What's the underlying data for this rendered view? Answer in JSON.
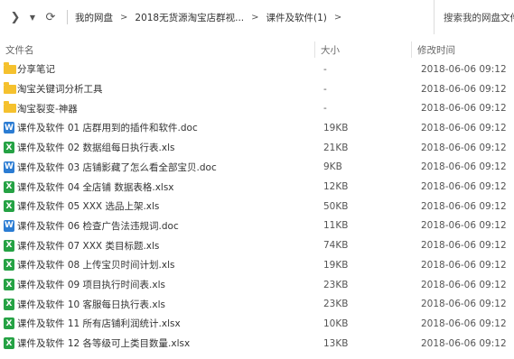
{
  "toolbar": {
    "breadcrumbs": [
      "我的网盘",
      "2018无货源淘宝店群视...",
      "课件及软件(1)"
    ],
    "search_placeholder": "搜索我的网盘文件"
  },
  "columns": {
    "name": "文件名",
    "size": "大小",
    "modified": "修改时间"
  },
  "files": [
    {
      "type": "folder",
      "name": "分享笔记",
      "size": "-",
      "date": "2018-06-06 09:12"
    },
    {
      "type": "folder",
      "name": "淘宝关键词分析工具",
      "size": "-",
      "date": "2018-06-06 09:12"
    },
    {
      "type": "folder",
      "name": "淘宝裂变-神器",
      "size": "-",
      "date": "2018-06-06 09:12"
    },
    {
      "type": "doc",
      "name": "课件及软件 01 店群用到的插件和软件.doc",
      "size": "19KB",
      "date": "2018-06-06 09:12"
    },
    {
      "type": "xls",
      "name": "课件及软件 02 数据组每日执行表.xls",
      "size": "21KB",
      "date": "2018-06-06 09:12"
    },
    {
      "type": "doc",
      "name": "课件及软件 03 店铺影藏了怎么看全部宝贝.doc",
      "size": "9KB",
      "date": "2018-06-06 09:12"
    },
    {
      "type": "xls",
      "name": "课件及软件 04 全店铺 数据表格.xlsx",
      "size": "12KB",
      "date": "2018-06-06 09:12"
    },
    {
      "type": "xls",
      "name": "课件及软件 05 XXX 选品上架.xls",
      "size": "50KB",
      "date": "2018-06-06 09:12"
    },
    {
      "type": "doc",
      "name": "课件及软件 06 检查广告法违规词.doc",
      "size": "11KB",
      "date": "2018-06-06 09:12"
    },
    {
      "type": "xls",
      "name": "课件及软件 07 XXX 类目标题.xls",
      "size": "74KB",
      "date": "2018-06-06 09:12"
    },
    {
      "type": "xls",
      "name": "课件及软件 08 上传宝贝时间计划.xls",
      "size": "19KB",
      "date": "2018-06-06 09:12"
    },
    {
      "type": "xls",
      "name": "课件及软件 09 项目执行时间表.xls",
      "size": "23KB",
      "date": "2018-06-06 09:12"
    },
    {
      "type": "xls",
      "name": "课件及软件 10 客服每日执行表.xls",
      "size": "23KB",
      "date": "2018-06-06 09:12"
    },
    {
      "type": "xls",
      "name": "课件及软件 11 所有店铺利润统计.xlsx",
      "size": "10KB",
      "date": "2018-06-06 09:12"
    },
    {
      "type": "xls",
      "name": "课件及软件 12 各等级可上类目数量.xlsx",
      "size": "13KB",
      "date": "2018-06-06 09:12"
    }
  ]
}
